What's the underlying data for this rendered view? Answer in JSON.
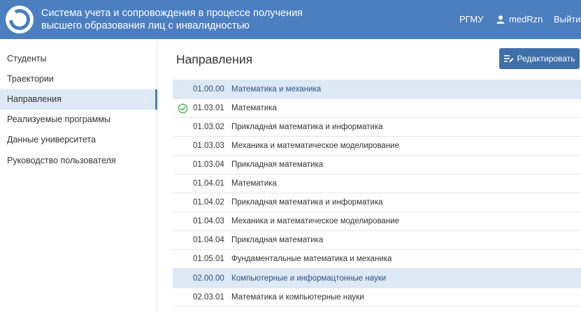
{
  "header": {
    "title_line1": "Система учета и сопровождения в процессе получения",
    "title_line2": "высшего образования лиц с инвалидностью",
    "university": "РГМУ",
    "username": "medRzn",
    "logout": "Выйти"
  },
  "sidebar": {
    "items": [
      {
        "label": "Студенты"
      },
      {
        "label": "Траектории"
      },
      {
        "label": "Направления",
        "active": true
      },
      {
        "label": "Реализуемые программы"
      },
      {
        "label": "Данные университета"
      },
      {
        "label": "Руководство пользователя"
      }
    ]
  },
  "main": {
    "title": "Направления",
    "edit_label": "Редактировать",
    "rows": [
      {
        "type": "group",
        "code": "01.00.00",
        "name": "Математика и механика"
      },
      {
        "type": "item",
        "code": "01.03.01",
        "name": "Математика",
        "checked": true
      },
      {
        "type": "item",
        "code": "01.03.02",
        "name": "Прикладная математика и информатика"
      },
      {
        "type": "item",
        "code": "01.03.03",
        "name": "Механика и математическое моделирование"
      },
      {
        "type": "item",
        "code": "01.03.04",
        "name": "Прикладная математика"
      },
      {
        "type": "item",
        "code": "01.04.01",
        "name": "Математика"
      },
      {
        "type": "item",
        "code": "01.04.02",
        "name": "Прикладная математика и информатика"
      },
      {
        "type": "item",
        "code": "01.04.03",
        "name": "Механика и математическое моделирование"
      },
      {
        "type": "item",
        "code": "01.04.04",
        "name": "Прикладная математика"
      },
      {
        "type": "item",
        "code": "01.05.01",
        "name": "Фундаментальные математика и механика"
      },
      {
        "type": "group",
        "code": "02.00.00",
        "name": "Компьютерные и информацтонные науки"
      },
      {
        "type": "item",
        "code": "02.03.01",
        "name": "Математика и компьютерные науки"
      }
    ]
  },
  "colors": {
    "header_bg": "#4b7fc0",
    "accent": "#3f6faa",
    "active_bg": "#dde9f5",
    "check": "#4caf50"
  },
  "icons": {
    "logo": "ring-logo-icon",
    "user": "user-icon",
    "edit": "edit-list-icon",
    "check": "check-circle-icon"
  }
}
